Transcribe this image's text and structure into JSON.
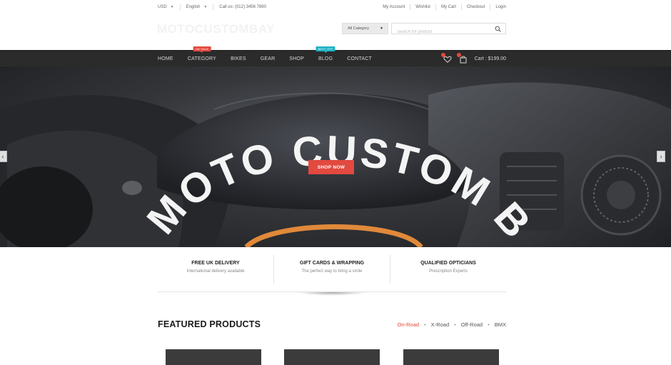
{
  "topbar": {
    "currency": "USD",
    "language": "English",
    "phone": "Call us: (012) 3456 7890",
    "links": [
      "My Account",
      "Wishlist",
      "My Cart",
      "Checkout",
      "Login"
    ]
  },
  "header": {
    "logo": "MOTOCUSTOMBAY",
    "category_select": "All Category",
    "search_placeholder": "Search for product"
  },
  "nav": {
    "items": [
      {
        "label": "HOME"
      },
      {
        "label": "CATEGORY",
        "badge": "ON SALE",
        "badge_color": "#e2493f"
      },
      {
        "label": "BIKES"
      },
      {
        "label": "GEAR"
      },
      {
        "label": "SHOP"
      },
      {
        "label": "BLOG",
        "badge": "BEST OFF",
        "badge_color": "#1fb0c3"
      },
      {
        "label": "CONTACT"
      }
    ],
    "cart_label": "Cart : $199.00"
  },
  "hero": {
    "headline": "MOTO CUSTOM BAY",
    "cta": "SHOP NOW",
    "cta_color": "#e2493f"
  },
  "features": [
    {
      "title": "FREE UK DELIVERY",
      "subtitle": "International delivery available"
    },
    {
      "title": "GIFT CARDS & WRAPPING",
      "subtitle": "The perfect way to bring a smile"
    },
    {
      "title": "QUALIFIED OPTICIANS",
      "subtitle": "Prescription Experts"
    }
  ],
  "featured": {
    "title": "FEATURED PRODUCTS",
    "tabs": [
      "On-Road",
      "X-Road",
      "Off-Road",
      "BMX"
    ],
    "active_tab": "On-Road"
  }
}
